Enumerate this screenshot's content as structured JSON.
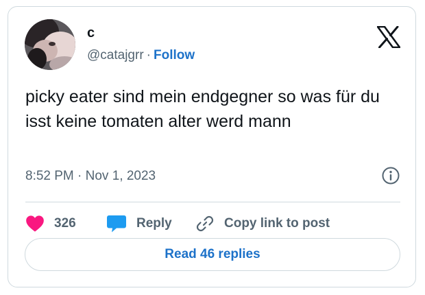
{
  "tweet": {
    "author": {
      "name": "c",
      "handle": "@catajgrr",
      "separator": "·",
      "follow_label": "Follow"
    },
    "text": "picky eater sind mein endgegner so was für du isst keine tomaten alter werd mann",
    "timestamp": "8:52 PM · Nov 1, 2023",
    "actions": {
      "likes": "326",
      "reply_label": "Reply",
      "copy_label": "Copy link to post"
    },
    "read_replies_label": "Read 46 replies"
  },
  "icons": {
    "logo": "x-logo-icon",
    "info": "info-icon",
    "like": "heart-icon",
    "reply": "speech-bubble-icon",
    "copy": "link-icon"
  },
  "colors": {
    "link": "#1d72c9",
    "heart": "#f91880",
    "reply_bubble": "#1d9bf0",
    "muted_text": "#536471",
    "border": "#cfd9de"
  }
}
